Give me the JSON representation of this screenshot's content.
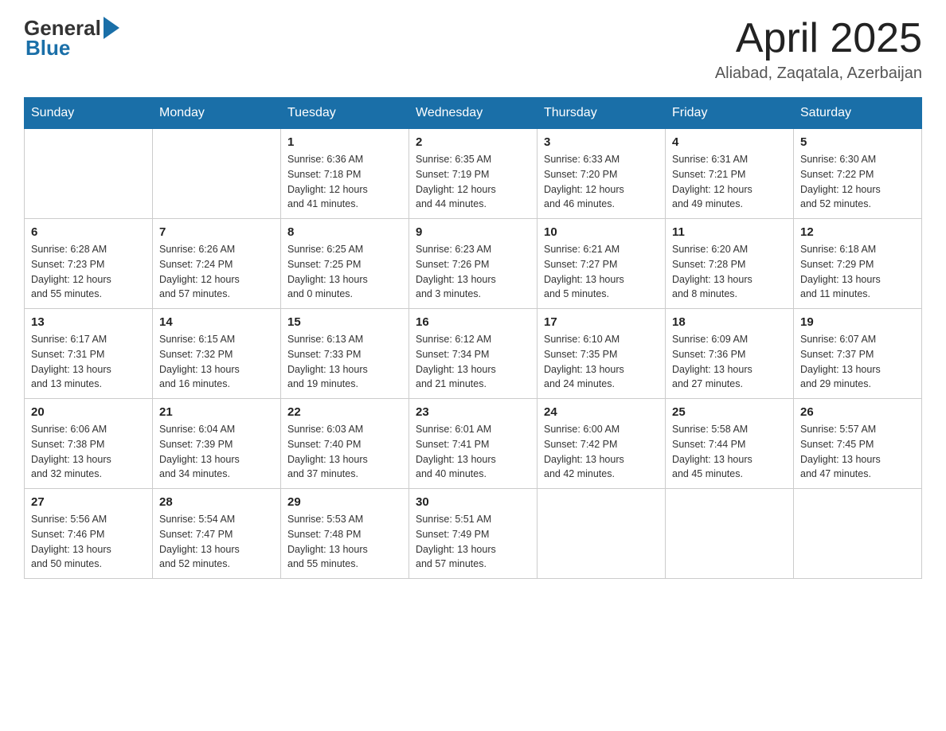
{
  "header": {
    "logo_general": "General",
    "logo_blue": "Blue",
    "month_title": "April 2025",
    "location": "Aliabad, Zaqatala, Azerbaijan"
  },
  "days_of_week": [
    "Sunday",
    "Monday",
    "Tuesday",
    "Wednesday",
    "Thursday",
    "Friday",
    "Saturday"
  ],
  "weeks": [
    [
      {
        "day": "",
        "info": ""
      },
      {
        "day": "",
        "info": ""
      },
      {
        "day": "1",
        "info": "Sunrise: 6:36 AM\nSunset: 7:18 PM\nDaylight: 12 hours\nand 41 minutes."
      },
      {
        "day": "2",
        "info": "Sunrise: 6:35 AM\nSunset: 7:19 PM\nDaylight: 12 hours\nand 44 minutes."
      },
      {
        "day": "3",
        "info": "Sunrise: 6:33 AM\nSunset: 7:20 PM\nDaylight: 12 hours\nand 46 minutes."
      },
      {
        "day": "4",
        "info": "Sunrise: 6:31 AM\nSunset: 7:21 PM\nDaylight: 12 hours\nand 49 minutes."
      },
      {
        "day": "5",
        "info": "Sunrise: 6:30 AM\nSunset: 7:22 PM\nDaylight: 12 hours\nand 52 minutes."
      }
    ],
    [
      {
        "day": "6",
        "info": "Sunrise: 6:28 AM\nSunset: 7:23 PM\nDaylight: 12 hours\nand 55 minutes."
      },
      {
        "day": "7",
        "info": "Sunrise: 6:26 AM\nSunset: 7:24 PM\nDaylight: 12 hours\nand 57 minutes."
      },
      {
        "day": "8",
        "info": "Sunrise: 6:25 AM\nSunset: 7:25 PM\nDaylight: 13 hours\nand 0 minutes."
      },
      {
        "day": "9",
        "info": "Sunrise: 6:23 AM\nSunset: 7:26 PM\nDaylight: 13 hours\nand 3 minutes."
      },
      {
        "day": "10",
        "info": "Sunrise: 6:21 AM\nSunset: 7:27 PM\nDaylight: 13 hours\nand 5 minutes."
      },
      {
        "day": "11",
        "info": "Sunrise: 6:20 AM\nSunset: 7:28 PM\nDaylight: 13 hours\nand 8 minutes."
      },
      {
        "day": "12",
        "info": "Sunrise: 6:18 AM\nSunset: 7:29 PM\nDaylight: 13 hours\nand 11 minutes."
      }
    ],
    [
      {
        "day": "13",
        "info": "Sunrise: 6:17 AM\nSunset: 7:31 PM\nDaylight: 13 hours\nand 13 minutes."
      },
      {
        "day": "14",
        "info": "Sunrise: 6:15 AM\nSunset: 7:32 PM\nDaylight: 13 hours\nand 16 minutes."
      },
      {
        "day": "15",
        "info": "Sunrise: 6:13 AM\nSunset: 7:33 PM\nDaylight: 13 hours\nand 19 minutes."
      },
      {
        "day": "16",
        "info": "Sunrise: 6:12 AM\nSunset: 7:34 PM\nDaylight: 13 hours\nand 21 minutes."
      },
      {
        "day": "17",
        "info": "Sunrise: 6:10 AM\nSunset: 7:35 PM\nDaylight: 13 hours\nand 24 minutes."
      },
      {
        "day": "18",
        "info": "Sunrise: 6:09 AM\nSunset: 7:36 PM\nDaylight: 13 hours\nand 27 minutes."
      },
      {
        "day": "19",
        "info": "Sunrise: 6:07 AM\nSunset: 7:37 PM\nDaylight: 13 hours\nand 29 minutes."
      }
    ],
    [
      {
        "day": "20",
        "info": "Sunrise: 6:06 AM\nSunset: 7:38 PM\nDaylight: 13 hours\nand 32 minutes."
      },
      {
        "day": "21",
        "info": "Sunrise: 6:04 AM\nSunset: 7:39 PM\nDaylight: 13 hours\nand 34 minutes."
      },
      {
        "day": "22",
        "info": "Sunrise: 6:03 AM\nSunset: 7:40 PM\nDaylight: 13 hours\nand 37 minutes."
      },
      {
        "day": "23",
        "info": "Sunrise: 6:01 AM\nSunset: 7:41 PM\nDaylight: 13 hours\nand 40 minutes."
      },
      {
        "day": "24",
        "info": "Sunrise: 6:00 AM\nSunset: 7:42 PM\nDaylight: 13 hours\nand 42 minutes."
      },
      {
        "day": "25",
        "info": "Sunrise: 5:58 AM\nSunset: 7:44 PM\nDaylight: 13 hours\nand 45 minutes."
      },
      {
        "day": "26",
        "info": "Sunrise: 5:57 AM\nSunset: 7:45 PM\nDaylight: 13 hours\nand 47 minutes."
      }
    ],
    [
      {
        "day": "27",
        "info": "Sunrise: 5:56 AM\nSunset: 7:46 PM\nDaylight: 13 hours\nand 50 minutes."
      },
      {
        "day": "28",
        "info": "Sunrise: 5:54 AM\nSunset: 7:47 PM\nDaylight: 13 hours\nand 52 minutes."
      },
      {
        "day": "29",
        "info": "Sunrise: 5:53 AM\nSunset: 7:48 PM\nDaylight: 13 hours\nand 55 minutes."
      },
      {
        "day": "30",
        "info": "Sunrise: 5:51 AM\nSunset: 7:49 PM\nDaylight: 13 hours\nand 57 minutes."
      },
      {
        "day": "",
        "info": ""
      },
      {
        "day": "",
        "info": ""
      },
      {
        "day": "",
        "info": ""
      }
    ]
  ]
}
